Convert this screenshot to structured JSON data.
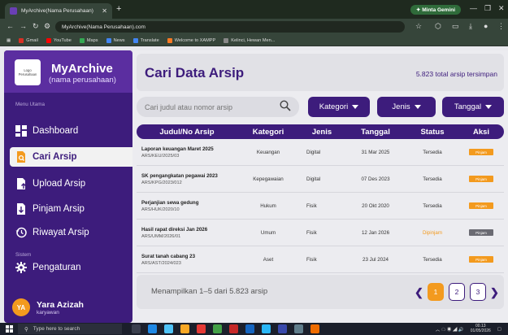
{
  "browser": {
    "tab_title": "MyArchive(Nama Perusahaan)",
    "tab_close": "✕",
    "new_tab": "+",
    "gemini_label": "✦ Minta Gemini",
    "url": "MyArchive(Nama Perusahaan).com",
    "bookmarks": [
      {
        "label": "Gmail",
        "color": "#d93025"
      },
      {
        "label": "YouTube",
        "color": "#ff0000"
      },
      {
        "label": "Maps",
        "color": "#34a853"
      },
      {
        "label": "News",
        "color": "#4285f4"
      },
      {
        "label": "Translate",
        "color": "#4285f4"
      },
      {
        "label": "Welcome to XAMPP",
        "color": "#fb7a24"
      },
      {
        "label": "Kelinci, Hewan Men...",
        "color": "#888888"
      }
    ]
  },
  "sidebar": {
    "logo_text": "Logo Perusahaan",
    "brand_name": "MyArchive",
    "brand_sub": "(nama perusahaan)",
    "main_menu_label": "Menu Utama",
    "system_label": "Sistem",
    "items": [
      {
        "label": "Dashboard",
        "icon": "dashboard-icon"
      },
      {
        "label": "Cari Arsip",
        "icon": "search-file-icon"
      },
      {
        "label": "Upload Arsip",
        "icon": "upload-file-icon"
      },
      {
        "label": "Pinjam Arsip",
        "icon": "download-file-icon"
      },
      {
        "label": "Riwayat Arsip",
        "icon": "history-icon"
      },
      {
        "label": "Pengaturan",
        "icon": "gear-icon"
      }
    ],
    "user": {
      "initials": "YA",
      "name": "Yara Azizah",
      "role": "karyawan"
    }
  },
  "header": {
    "title": "Cari Data Arsip",
    "total": "5.823 total arsip tersimpan"
  },
  "search": {
    "placeholder": "Cari judul atau nomor arsip"
  },
  "filters": {
    "category": "Kategori",
    "type": "Jenis",
    "date": "Tanggal"
  },
  "table": {
    "columns": [
      "Judul/No Arsip",
      "Kategori",
      "Jenis",
      "Tanggal",
      "Status",
      "Aksi"
    ],
    "rows": [
      {
        "title": "Laporan keuangan Maret 2025",
        "number": "ARS/KEU/2025/03",
        "category": "Keuangan",
        "type": "Digital",
        "date": "31 Mar 2025",
        "status": "Tersedia",
        "action": "Pinjam"
      },
      {
        "title": "SK pengangkatan pegawai 2023",
        "number": "ARS/KPG/2023/012",
        "category": "Kepegawaian",
        "type": "Digital",
        "date": "07 Des 2023",
        "status": "Tersedia",
        "action": "Pinjam"
      },
      {
        "title": "Perjanjian sewa gedung",
        "number": "ARS/HUK/2020/10",
        "category": "Hukum",
        "type": "Fisik",
        "date": "20 Okt 2020",
        "status": "Tersedia",
        "action": "Pinjam"
      },
      {
        "title": "Hasil rapat direksi Jan 2026",
        "number": "ARS/UMM/2026/01",
        "category": "Umum",
        "type": "Fisik",
        "date": "12 Jan 2026",
        "status": "Dipinjam",
        "action": "Pinjam"
      },
      {
        "title": "Surat tanah cabang 23",
        "number": "ARS/AST/2024/023",
        "category": "Aset",
        "type": "Fisik",
        "date": "23 Jul 2024",
        "status": "Tersedia",
        "action": "Pinjam"
      }
    ]
  },
  "footer": {
    "showing": "Menampilkan 1–5 dari 5.823 arsip",
    "pages": [
      "1",
      "2",
      "3"
    ],
    "active_page": "1"
  },
  "taskbar": {
    "search_placeholder": "Type here to search",
    "time": "00.13",
    "date": "01/05/2026"
  },
  "colors": {
    "primary": "#3d1c7c",
    "accent": "#f39a1e"
  }
}
